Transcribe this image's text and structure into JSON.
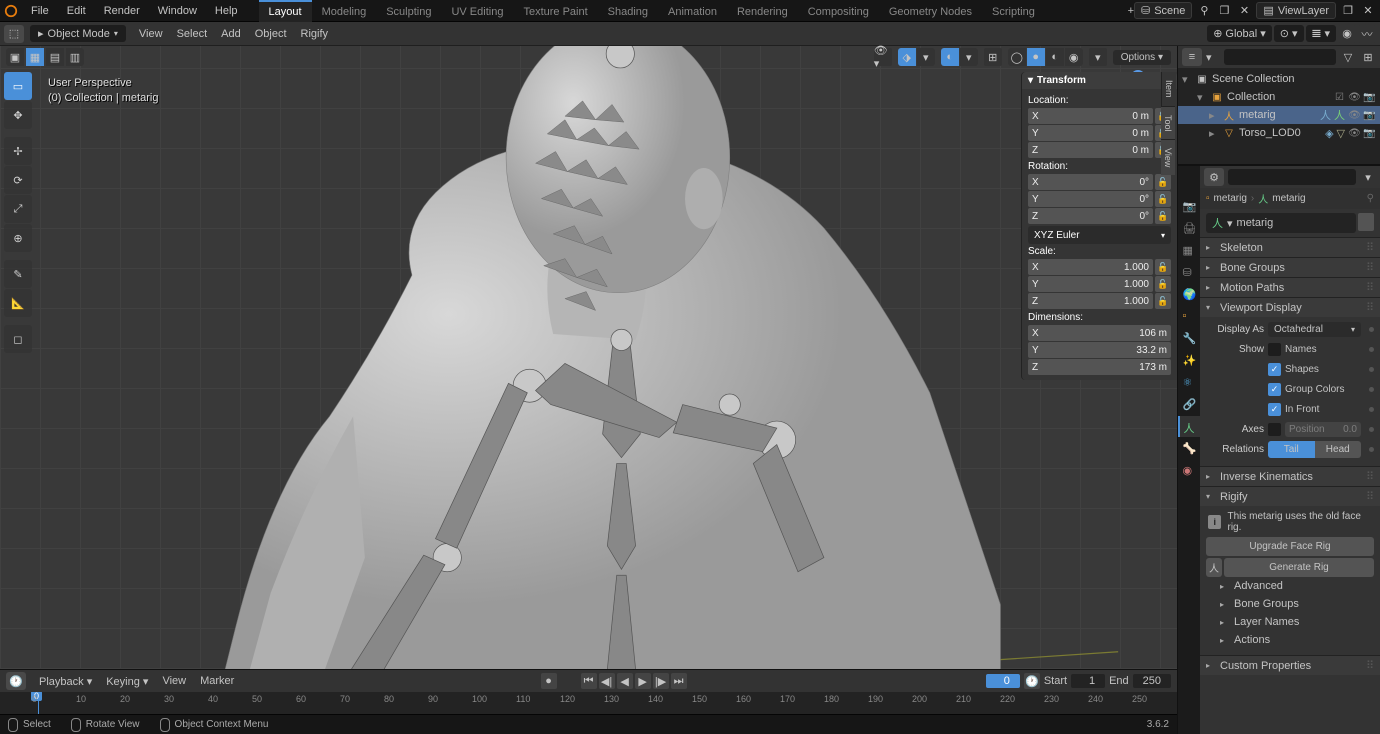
{
  "top_menu": {
    "items": [
      "File",
      "Edit",
      "Render",
      "Window",
      "Help"
    ]
  },
  "workspaces": {
    "tabs": [
      "Layout",
      "Modeling",
      "Sculpting",
      "UV Editing",
      "Texture Paint",
      "Shading",
      "Animation",
      "Rendering",
      "Compositing",
      "Geometry Nodes",
      "Scripting"
    ],
    "active": 0
  },
  "scene": {
    "label": "Scene"
  },
  "viewlayer": {
    "label": "ViewLayer"
  },
  "mode": {
    "label": "Object Mode"
  },
  "header_menus": [
    "View",
    "Select",
    "Add",
    "Object",
    "Rigify"
  ],
  "orientation": {
    "label": "Global"
  },
  "options": {
    "label": "Options"
  },
  "viewport_info": {
    "line1": "User Perspective",
    "line2": "(0) Collection | metarig"
  },
  "n_panel": {
    "header": "Transform",
    "tabs": [
      "Item",
      "Tool",
      "View"
    ],
    "loc_label": "Location:",
    "rot_label": "Rotation:",
    "scale_label": "Scale:",
    "dim_label": "Dimensions:",
    "loc": {
      "x": "0 m",
      "y": "0 m",
      "z": "0 m"
    },
    "rot": {
      "x": "0°",
      "y": "0°",
      "z": "0°"
    },
    "rot_mode": "XYZ Euler",
    "scale": {
      "x": "1.000",
      "y": "1.000",
      "z": "1.000"
    },
    "dim": {
      "x": "106 m",
      "y": "33.2 m",
      "z": "173 m"
    }
  },
  "timeline": {
    "menus": [
      "Playback",
      "Keying",
      "View",
      "Marker"
    ],
    "current": "0",
    "start_label": "Start",
    "start": "1",
    "end_label": "End",
    "end": "250",
    "ticks": [
      "0",
      "10",
      "20",
      "30",
      "40",
      "50",
      "60",
      "70",
      "80",
      "90",
      "100",
      "110",
      "120",
      "130",
      "140",
      "150",
      "160",
      "170",
      "180",
      "190",
      "200",
      "210",
      "220",
      "230",
      "240",
      "250"
    ]
  },
  "status": {
    "left": "Select",
    "mid": "Rotate View",
    "right": "Object Context Menu",
    "version": "3.6.2"
  },
  "outliner": {
    "root": "Scene Collection",
    "collection": "Collection",
    "items": [
      {
        "name": "metarig"
      },
      {
        "name": "Torso_LOD0"
      }
    ]
  },
  "breadcrumb": {
    "a": "metarig",
    "b": "metarig"
  },
  "prop_name": "metarig",
  "panels": {
    "skeleton": "Skeleton",
    "bone_groups": "Bone Groups",
    "motion_paths": "Motion Paths",
    "viewport_display": "Viewport Display",
    "ik": "Inverse Kinematics",
    "rigify": "Rigify",
    "advanced": "Advanced",
    "bone_groups2": "Bone Groups",
    "layer_names": "Layer Names",
    "actions": "Actions",
    "custom_props": "Custom Properties"
  },
  "vdisplay": {
    "display_as_lbl": "Display As",
    "display_as": "Octahedral",
    "show_lbl": "Show",
    "names": "Names",
    "shapes": "Shapes",
    "group_colors": "Group Colors",
    "in_front": "In Front",
    "axes_lbl": "Axes",
    "position_lbl": "Position",
    "position": "0.0",
    "relations_lbl": "Relations",
    "tail": "Tail",
    "head": "Head"
  },
  "rigify": {
    "msg": "This metarig uses the old face rig.",
    "upgrade": "Upgrade Face Rig",
    "generate": "Generate Rig"
  }
}
